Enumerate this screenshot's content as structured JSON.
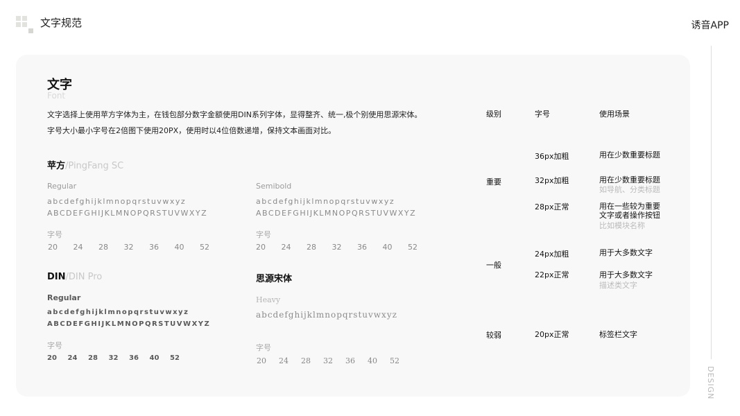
{
  "header": {
    "title": "文字规范",
    "app_name": "诱音APP",
    "side_label": "DESIGN"
  },
  "section": {
    "title": "文字",
    "subtitle": "Font",
    "desc_lines": [
      "文字选择上使用苹方字体为主，在钱包部分数字金额使用DIN系列字体，显得整齐、统一,极个别使用思源宋体。",
      "字号大小最小字号在2倍图下使用20PX，使用时以4位倍数递增，保持文本画面对比。"
    ]
  },
  "fonts": {
    "pingfang": {
      "name": "苹方",
      "alt": "/PingFang SC"
    },
    "din": {
      "name": "DIN",
      "alt": "/DIN Pro"
    },
    "siyuan": {
      "name": "思源宋体"
    }
  },
  "specimens": {
    "pf_regular": {
      "weight": "Regular",
      "lower": "abcdefghijklmnopqrstuvwxyz",
      "upper": "ABCDEFGHIJKLMNOPQRSTUVWXYZ"
    },
    "pf_semibold": {
      "weight": "Semibold",
      "lower": "abcdefghijklmnopqrstuvwxyz",
      "upper": "ABCDEFGHIJKLMNOPQRSTUVWXYZ"
    },
    "din_regular": {
      "weight": "Regular",
      "lower": "abcdefghijklmnopqrstuvwxyz",
      "upper": "ABCDEFGHIJKLMNOPQRSTUVWXYZ"
    },
    "siyuan_heavy": {
      "weight": "Heavy",
      "lower": "abcdefghijklmnopqrstuvwxyz"
    }
  },
  "size_label": "字号",
  "sizes": [
    "20",
    "24",
    "28",
    "32",
    "36",
    "40",
    "52"
  ],
  "table": {
    "headers": {
      "level": "级别",
      "size": "字号",
      "usage": "使用场景"
    },
    "levels": {
      "important": "重要",
      "normal": "一般",
      "weak": "较弱"
    },
    "rows": [
      {
        "size": "36px加粗",
        "usage": "用在少数重要标题",
        "note": ""
      },
      {
        "size": "32px加粗",
        "usage": "用在少数重要标题",
        "note": "如导航、分类标题"
      },
      {
        "size": "28px正常",
        "usage": "用在一些较为重要",
        "usage2": "文字或者操作按钮",
        "note": "比如模块名称"
      },
      {
        "size": "24px加粗",
        "usage": "用于大多数文字",
        "note": ""
      },
      {
        "size": "22px正常",
        "usage": "用于大多数文字",
        "note": "描述类文字"
      },
      {
        "size": "20px正常",
        "usage": "标签栏文字",
        "note": ""
      }
    ]
  },
  "colors": {
    "card_bg": "#f8f8f8",
    "logo": "#e2e2de",
    "muted": "#bbbbbb"
  }
}
